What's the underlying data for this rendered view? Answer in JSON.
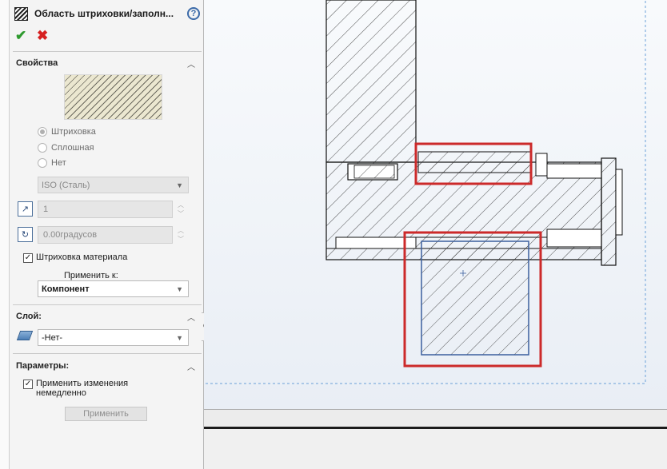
{
  "property_manager": {
    "title": "Область штриховки/заполн...",
    "title_icon": "hatch-fill-icon",
    "help_label": "?",
    "ok_label": "✔",
    "cancel_label": "✖",
    "properties": {
      "heading": "Свойства",
      "radios": [
        {
          "label": "Штриховка",
          "selected": true
        },
        {
          "label": "Сплошная",
          "selected": false
        },
        {
          "label": "Нет",
          "selected": false
        }
      ],
      "pattern_select": "ISO (Сталь)",
      "scale_value": "1",
      "angle_value": "0.00градусов",
      "material_hatch_label": "Штриховка материала",
      "material_hatch_checked": true,
      "apply_to_label": "Применить к:",
      "apply_to_value": "Компонент"
    },
    "layer": {
      "heading": "Слой:",
      "value": "-Нет-"
    },
    "parameters": {
      "heading": "Параметры:",
      "apply_immediately_label_line1": "Применить изменения",
      "apply_immediately_label_line2": "немедленно",
      "apply_immediately_checked": true,
      "apply_button": "Применить"
    }
  },
  "colors": {
    "highlight": "#cc2a2a",
    "ok": "#2e9a2e",
    "cancel": "#d62020",
    "selection": "#3b5f9e"
  }
}
